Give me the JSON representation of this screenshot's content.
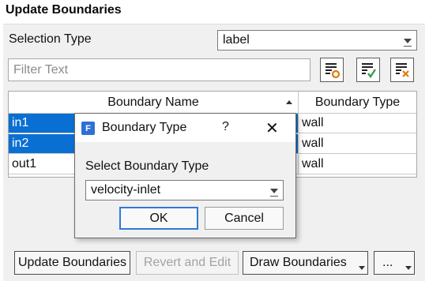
{
  "panel": {
    "title": "Update Boundaries"
  },
  "selection": {
    "label": "Selection Type",
    "value": "label"
  },
  "filter": {
    "placeholder": "Filter Text",
    "value": ""
  },
  "toolbar": {
    "icons": [
      "filter-select-icon",
      "select-all-check-icon",
      "deselect-all-x-icon"
    ]
  },
  "table": {
    "headers": {
      "name": "Boundary Name",
      "type": "Boundary Type"
    },
    "sort": "ascending",
    "rows": [
      {
        "name": "in1",
        "type": "wall",
        "selected": true
      },
      {
        "name": "in2",
        "type": "wall",
        "selected": true
      },
      {
        "name": "out1",
        "type": "wall",
        "selected": false
      }
    ]
  },
  "buttons": {
    "update": "Update Boundaries",
    "revert": "Revert and Edit",
    "draw": "Draw Boundaries",
    "more": "..."
  },
  "dialog": {
    "title": "Boundary Type",
    "app_icon": "F",
    "help": "?",
    "close": "✕",
    "label": "Select Boundary Type",
    "value": "velocity-inlet",
    "ok": "OK",
    "cancel": "Cancel"
  },
  "colors": {
    "selection": "#0a6fd2",
    "accent": "#2f7ad8",
    "icon_orange": "#e07b12",
    "icon_green": "#3aa04a"
  }
}
